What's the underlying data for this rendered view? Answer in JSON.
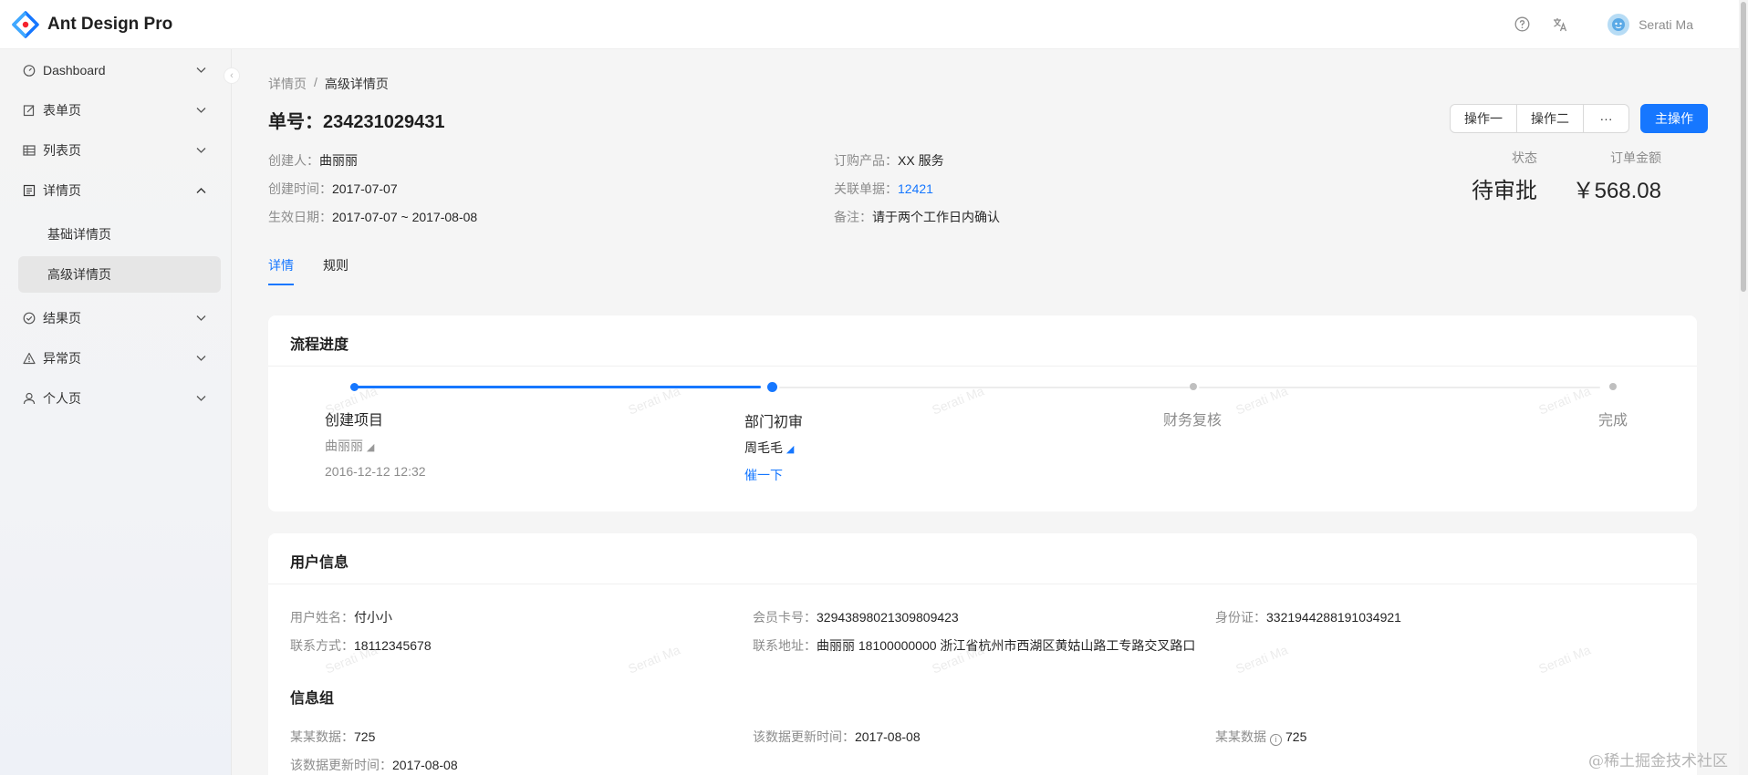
{
  "app": {
    "title": "Ant Design Pro"
  },
  "header": {
    "user_name": "Serati Ma"
  },
  "sidebar": {
    "items": [
      {
        "label": "Dashboard",
        "icon": "dashboard-icon"
      },
      {
        "label": "表单页",
        "icon": "form-icon"
      },
      {
        "label": "列表页",
        "icon": "table-icon"
      },
      {
        "label": "详情页",
        "icon": "profile-icon"
      },
      {
        "label": "结果页",
        "icon": "check-circle-icon"
      },
      {
        "label": "异常页",
        "icon": "warning-icon"
      },
      {
        "label": "个人页",
        "icon": "user-icon"
      }
    ],
    "sub_items": [
      {
        "label": "基础详情页"
      },
      {
        "label": "高级详情页"
      }
    ]
  },
  "breadcrumb": {
    "items": [
      "详情页",
      "高级详情页"
    ],
    "separator": "/"
  },
  "page": {
    "title": "单号：234231029431",
    "actions": {
      "action1": "操作一",
      "action2": "操作二",
      "more": "···",
      "primary": "主操作"
    }
  },
  "description": {
    "left": [
      {
        "key": "创建人：",
        "value": "曲丽丽"
      },
      {
        "key": "创建时间：",
        "value": "2017-07-07"
      },
      {
        "key": "生效日期：",
        "value": "2017-07-07 ~ 2017-08-08"
      }
    ],
    "right": [
      {
        "key": "订购产品：",
        "value": "XX 服务"
      },
      {
        "key": "关联单据：",
        "value": "12421"
      },
      {
        "key": "备注：",
        "value": "请于两个工作日内确认"
      }
    ]
  },
  "stats": [
    {
      "label": "状态",
      "value": "待审批"
    },
    {
      "label": "订单金额",
      "value": "￥568.08"
    }
  ],
  "tabs": [
    {
      "label": "详情"
    },
    {
      "label": "规则"
    }
  ],
  "progress": {
    "title": "流程进度",
    "steps": [
      {
        "title": "创建项目",
        "person": "曲丽丽",
        "time": "2016-12-12 12:32",
        "status": "finish"
      },
      {
        "title": "部门初审",
        "person": "周毛毛",
        "action": "催一下",
        "status": "process"
      },
      {
        "title": "财务复核",
        "status": "wait"
      },
      {
        "title": "完成",
        "status": "wait"
      }
    ]
  },
  "user_info": {
    "title": "用户信息",
    "row1": [
      {
        "key": "用户姓名：",
        "value": "付小小"
      },
      {
        "key": "会员卡号：",
        "value": "32943898021309809423"
      },
      {
        "key": "身份证：",
        "value": "3321944288191034921"
      }
    ],
    "row2": [
      {
        "key": "联系方式：",
        "value": "18112345678"
      },
      {
        "key": "联系地址：",
        "value": "曲丽丽 18100000000 浙江省杭州市西湖区黄姑山路工专路交叉路口"
      }
    ],
    "group": {
      "title": "信息组",
      "row1": [
        {
          "key": "某某数据：",
          "value": "725"
        },
        {
          "key": "该数据更新时间：",
          "value": "2017-08-08"
        },
        {
          "key": "某某数据",
          "value": "725"
        }
      ],
      "row2": [
        {
          "key": "该数据更新时间：",
          "value": "2017-08-08"
        }
      ]
    }
  },
  "watermark": {
    "text": "Serati Ma",
    "corner": "@稀土掘金技术社区"
  },
  "colors": {
    "primary": "#1677ff",
    "wait": "#d9d9d9"
  }
}
